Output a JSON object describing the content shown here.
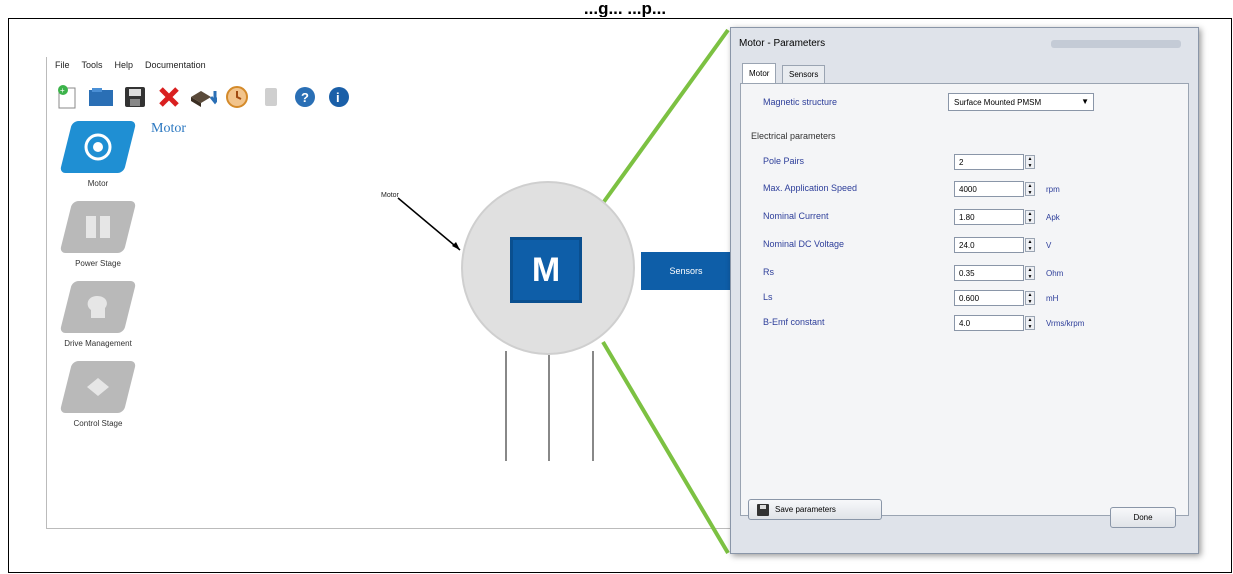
{
  "figure_title": "...g... ...p...",
  "menu": [
    "File",
    "Tools",
    "Help",
    "Documentation"
  ],
  "toolbar_icons": [
    "new-icon",
    "open-icon",
    "save-icon",
    "delete-icon",
    "generate-icon",
    "clock-icon",
    "disabled-icon",
    "help-icon",
    "info-icon"
  ],
  "sidebar": {
    "items": [
      {
        "label": "Motor",
        "icon": "motor-icon",
        "active": true
      },
      {
        "label": "Power Stage",
        "icon": "power-stage-icon",
        "active": false
      },
      {
        "label": "Drive Management",
        "icon": "drive-management-icon",
        "active": false
      },
      {
        "label": "Control Stage",
        "icon": "control-stage-icon",
        "active": false
      }
    ]
  },
  "main": {
    "section_title": "Motor",
    "diagram": {
      "motor_label": "Motor",
      "center_letter": "M",
      "sensors_label": "Sensors"
    }
  },
  "dialog": {
    "title": "Motor - Parameters",
    "tabs": [
      "Motor",
      "Sensors"
    ],
    "magnetic_structure_label": "Magnetic structure",
    "magnetic_structure_value": "Surface Mounted PMSM",
    "electrical_group_label": "Electrical parameters",
    "params": [
      {
        "label": "Pole Pairs",
        "value": "2",
        "unit": ""
      },
      {
        "label": "Max. Application Speed",
        "value": "4000",
        "unit": "rpm"
      },
      {
        "label": "Nominal Current",
        "value": "1.80",
        "unit": "Apk"
      },
      {
        "label": "Nominal DC Voltage",
        "value": "24.0",
        "unit": "V"
      },
      {
        "label": "Rs",
        "value": "0.35",
        "unit": "Ohm"
      },
      {
        "label": "Ls",
        "value": "0.600",
        "unit": "mH"
      },
      {
        "label": "B-Emf constant",
        "value": "4.0",
        "unit": "Vrms/krpm"
      }
    ],
    "save_label": "Save parameters",
    "done_label": "Done"
  },
  "colors": {
    "accent": "#1f8fd3",
    "motor_blue": "#0e5ea8",
    "connector_green": "#7cc142",
    "param_label": "#2d3e9a"
  }
}
